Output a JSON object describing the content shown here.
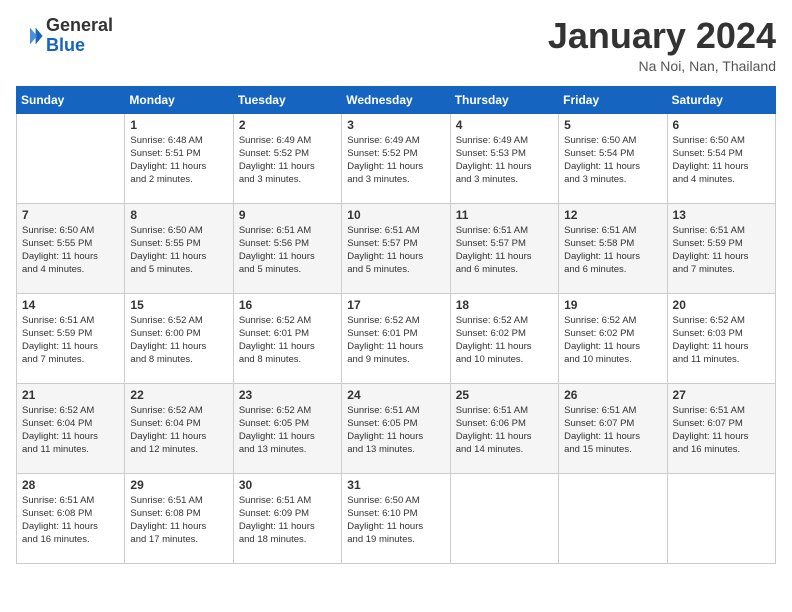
{
  "header": {
    "logo_general": "General",
    "logo_blue": "Blue",
    "calendar_title": "January 2024",
    "calendar_subtitle": "Na Noi, Nan, Thailand"
  },
  "days_of_week": [
    "Sunday",
    "Monday",
    "Tuesday",
    "Wednesday",
    "Thursday",
    "Friday",
    "Saturday"
  ],
  "weeks": [
    [
      {
        "day": "",
        "info": ""
      },
      {
        "day": "1",
        "info": "Sunrise: 6:48 AM\nSunset: 5:51 PM\nDaylight: 11 hours\nand 2 minutes."
      },
      {
        "day": "2",
        "info": "Sunrise: 6:49 AM\nSunset: 5:52 PM\nDaylight: 11 hours\nand 3 minutes."
      },
      {
        "day": "3",
        "info": "Sunrise: 6:49 AM\nSunset: 5:52 PM\nDaylight: 11 hours\nand 3 minutes."
      },
      {
        "day": "4",
        "info": "Sunrise: 6:49 AM\nSunset: 5:53 PM\nDaylight: 11 hours\nand 3 minutes."
      },
      {
        "day": "5",
        "info": "Sunrise: 6:50 AM\nSunset: 5:54 PM\nDaylight: 11 hours\nand 3 minutes."
      },
      {
        "day": "6",
        "info": "Sunrise: 6:50 AM\nSunset: 5:54 PM\nDaylight: 11 hours\nand 4 minutes."
      }
    ],
    [
      {
        "day": "7",
        "info": "Sunrise: 6:50 AM\nSunset: 5:55 PM\nDaylight: 11 hours\nand 4 minutes."
      },
      {
        "day": "8",
        "info": "Sunrise: 6:50 AM\nSunset: 5:55 PM\nDaylight: 11 hours\nand 5 minutes."
      },
      {
        "day": "9",
        "info": "Sunrise: 6:51 AM\nSunset: 5:56 PM\nDaylight: 11 hours\nand 5 minutes."
      },
      {
        "day": "10",
        "info": "Sunrise: 6:51 AM\nSunset: 5:57 PM\nDaylight: 11 hours\nand 5 minutes."
      },
      {
        "day": "11",
        "info": "Sunrise: 6:51 AM\nSunset: 5:57 PM\nDaylight: 11 hours\nand 6 minutes."
      },
      {
        "day": "12",
        "info": "Sunrise: 6:51 AM\nSunset: 5:58 PM\nDaylight: 11 hours\nand 6 minutes."
      },
      {
        "day": "13",
        "info": "Sunrise: 6:51 AM\nSunset: 5:59 PM\nDaylight: 11 hours\nand 7 minutes."
      }
    ],
    [
      {
        "day": "14",
        "info": "Sunrise: 6:51 AM\nSunset: 5:59 PM\nDaylight: 11 hours\nand 7 minutes."
      },
      {
        "day": "15",
        "info": "Sunrise: 6:52 AM\nSunset: 6:00 PM\nDaylight: 11 hours\nand 8 minutes."
      },
      {
        "day": "16",
        "info": "Sunrise: 6:52 AM\nSunset: 6:01 PM\nDaylight: 11 hours\nand 8 minutes."
      },
      {
        "day": "17",
        "info": "Sunrise: 6:52 AM\nSunset: 6:01 PM\nDaylight: 11 hours\nand 9 minutes."
      },
      {
        "day": "18",
        "info": "Sunrise: 6:52 AM\nSunset: 6:02 PM\nDaylight: 11 hours\nand 10 minutes."
      },
      {
        "day": "19",
        "info": "Sunrise: 6:52 AM\nSunset: 6:02 PM\nDaylight: 11 hours\nand 10 minutes."
      },
      {
        "day": "20",
        "info": "Sunrise: 6:52 AM\nSunset: 6:03 PM\nDaylight: 11 hours\nand 11 minutes."
      }
    ],
    [
      {
        "day": "21",
        "info": "Sunrise: 6:52 AM\nSunset: 6:04 PM\nDaylight: 11 hours\nand 11 minutes."
      },
      {
        "day": "22",
        "info": "Sunrise: 6:52 AM\nSunset: 6:04 PM\nDaylight: 11 hours\nand 12 minutes."
      },
      {
        "day": "23",
        "info": "Sunrise: 6:52 AM\nSunset: 6:05 PM\nDaylight: 11 hours\nand 13 minutes."
      },
      {
        "day": "24",
        "info": "Sunrise: 6:51 AM\nSunset: 6:05 PM\nDaylight: 11 hours\nand 13 minutes."
      },
      {
        "day": "25",
        "info": "Sunrise: 6:51 AM\nSunset: 6:06 PM\nDaylight: 11 hours\nand 14 minutes."
      },
      {
        "day": "26",
        "info": "Sunrise: 6:51 AM\nSunset: 6:07 PM\nDaylight: 11 hours\nand 15 minutes."
      },
      {
        "day": "27",
        "info": "Sunrise: 6:51 AM\nSunset: 6:07 PM\nDaylight: 11 hours\nand 16 minutes."
      }
    ],
    [
      {
        "day": "28",
        "info": "Sunrise: 6:51 AM\nSunset: 6:08 PM\nDaylight: 11 hours\nand 16 minutes."
      },
      {
        "day": "29",
        "info": "Sunrise: 6:51 AM\nSunset: 6:08 PM\nDaylight: 11 hours\nand 17 minutes."
      },
      {
        "day": "30",
        "info": "Sunrise: 6:51 AM\nSunset: 6:09 PM\nDaylight: 11 hours\nand 18 minutes."
      },
      {
        "day": "31",
        "info": "Sunrise: 6:50 AM\nSunset: 6:10 PM\nDaylight: 11 hours\nand 19 minutes."
      },
      {
        "day": "",
        "info": ""
      },
      {
        "day": "",
        "info": ""
      },
      {
        "day": "",
        "info": ""
      }
    ]
  ]
}
